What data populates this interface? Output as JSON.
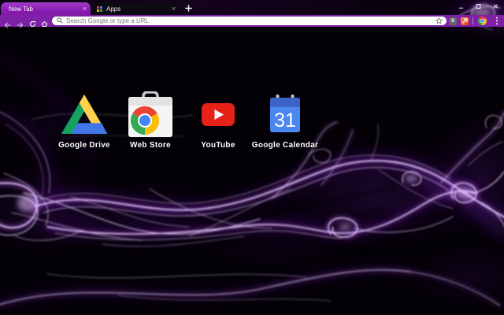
{
  "window_title": "New Tab",
  "tabs": [
    {
      "label": "New Tab",
      "active": true
    },
    {
      "label": "Apps",
      "active": false
    }
  ],
  "icons": {
    "tab_close": "×",
    "new_tab_plus": "+",
    "menu": "kebab-menu",
    "bookmark_star": "star-outline",
    "search": "magnifier"
  },
  "omnibox": {
    "placeholder": "Search Google or type a URL",
    "value": ""
  },
  "extensions": [
    {
      "label": "S"
    },
    {
      "label": ""
    }
  ],
  "apps": [
    {
      "label": "Google Drive"
    },
    {
      "label": "Web Store"
    },
    {
      "label": "YouTube"
    },
    {
      "label": "Google Calendar",
      "day": "31"
    }
  ],
  "colors": {
    "toolbar": "#7e21a6",
    "tab_active_top": "#a13cc9",
    "tab_active_bottom": "#811aa9",
    "tab_inactive": "#0e0a11",
    "smoke_accent": "#a335e8",
    "youtube_red": "#e62117",
    "calendar_blue": "#4a87ee",
    "calendar_blue_dark": "#3b63c6",
    "drive_green": "#15a15f",
    "drive_yellow": "#ffd04b",
    "drive_blue": "#4175e8",
    "chrome_red": "#ea4335",
    "chrome_green": "#34a853",
    "chrome_yellow": "#fbbc05",
    "chrome_blue": "#4285f4"
  }
}
